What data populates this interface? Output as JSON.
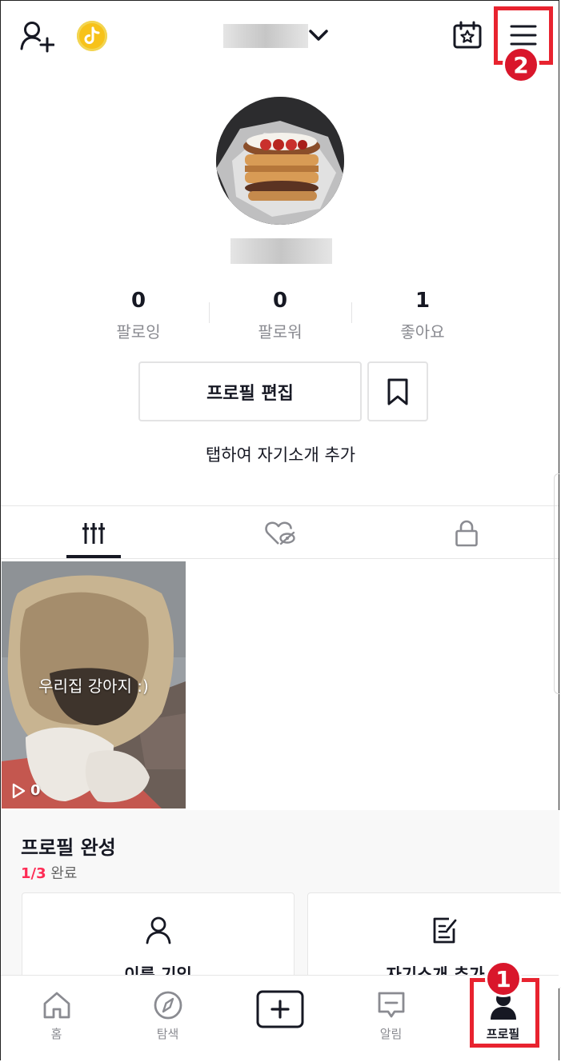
{
  "header": {
    "account_switch_label": ""
  },
  "profile": {
    "username": ""
  },
  "stats": [
    {
      "value": "0",
      "label": "팔로잉"
    },
    {
      "value": "0",
      "label": "팔로워"
    },
    {
      "value": "1",
      "label": "좋아요"
    }
  ],
  "actions": {
    "edit_profile_label": "프로필 편집"
  },
  "bio": {
    "placeholder_text": "탭하여 자기소개 추가"
  },
  "tabs": [
    {
      "icon": "grid-icon",
      "active": true
    },
    {
      "icon": "liked-hidden-icon",
      "active": false
    },
    {
      "icon": "lock-icon",
      "active": false
    }
  ],
  "videos": [
    {
      "caption": "우리집 강아지 :)",
      "plays": "0"
    }
  ],
  "profile_completion": {
    "title": "프로필 완성",
    "progress_count": "1/3",
    "progress_label": "완료",
    "cards": [
      {
        "icon": "person-icon",
        "title": "이름 기입"
      },
      {
        "icon": "edit-note-icon",
        "title": "자기소개 추가"
      }
    ]
  },
  "bottom_nav": [
    {
      "label": "홈",
      "icon": "home-icon",
      "active": false
    },
    {
      "label": "탐색",
      "icon": "compass-icon",
      "active": false
    },
    {
      "label": "",
      "icon": "plus-icon",
      "active": false
    },
    {
      "label": "알림",
      "icon": "inbox-icon",
      "active": false
    },
    {
      "label": "프로필",
      "icon": "profile-icon",
      "active": true
    }
  ],
  "annotations": [
    {
      "number": "1"
    },
    {
      "number": "2"
    }
  ],
  "colors": {
    "accent": "#fe2c55",
    "annotation_red": "#e8232f",
    "coin": "#f7c21a"
  }
}
